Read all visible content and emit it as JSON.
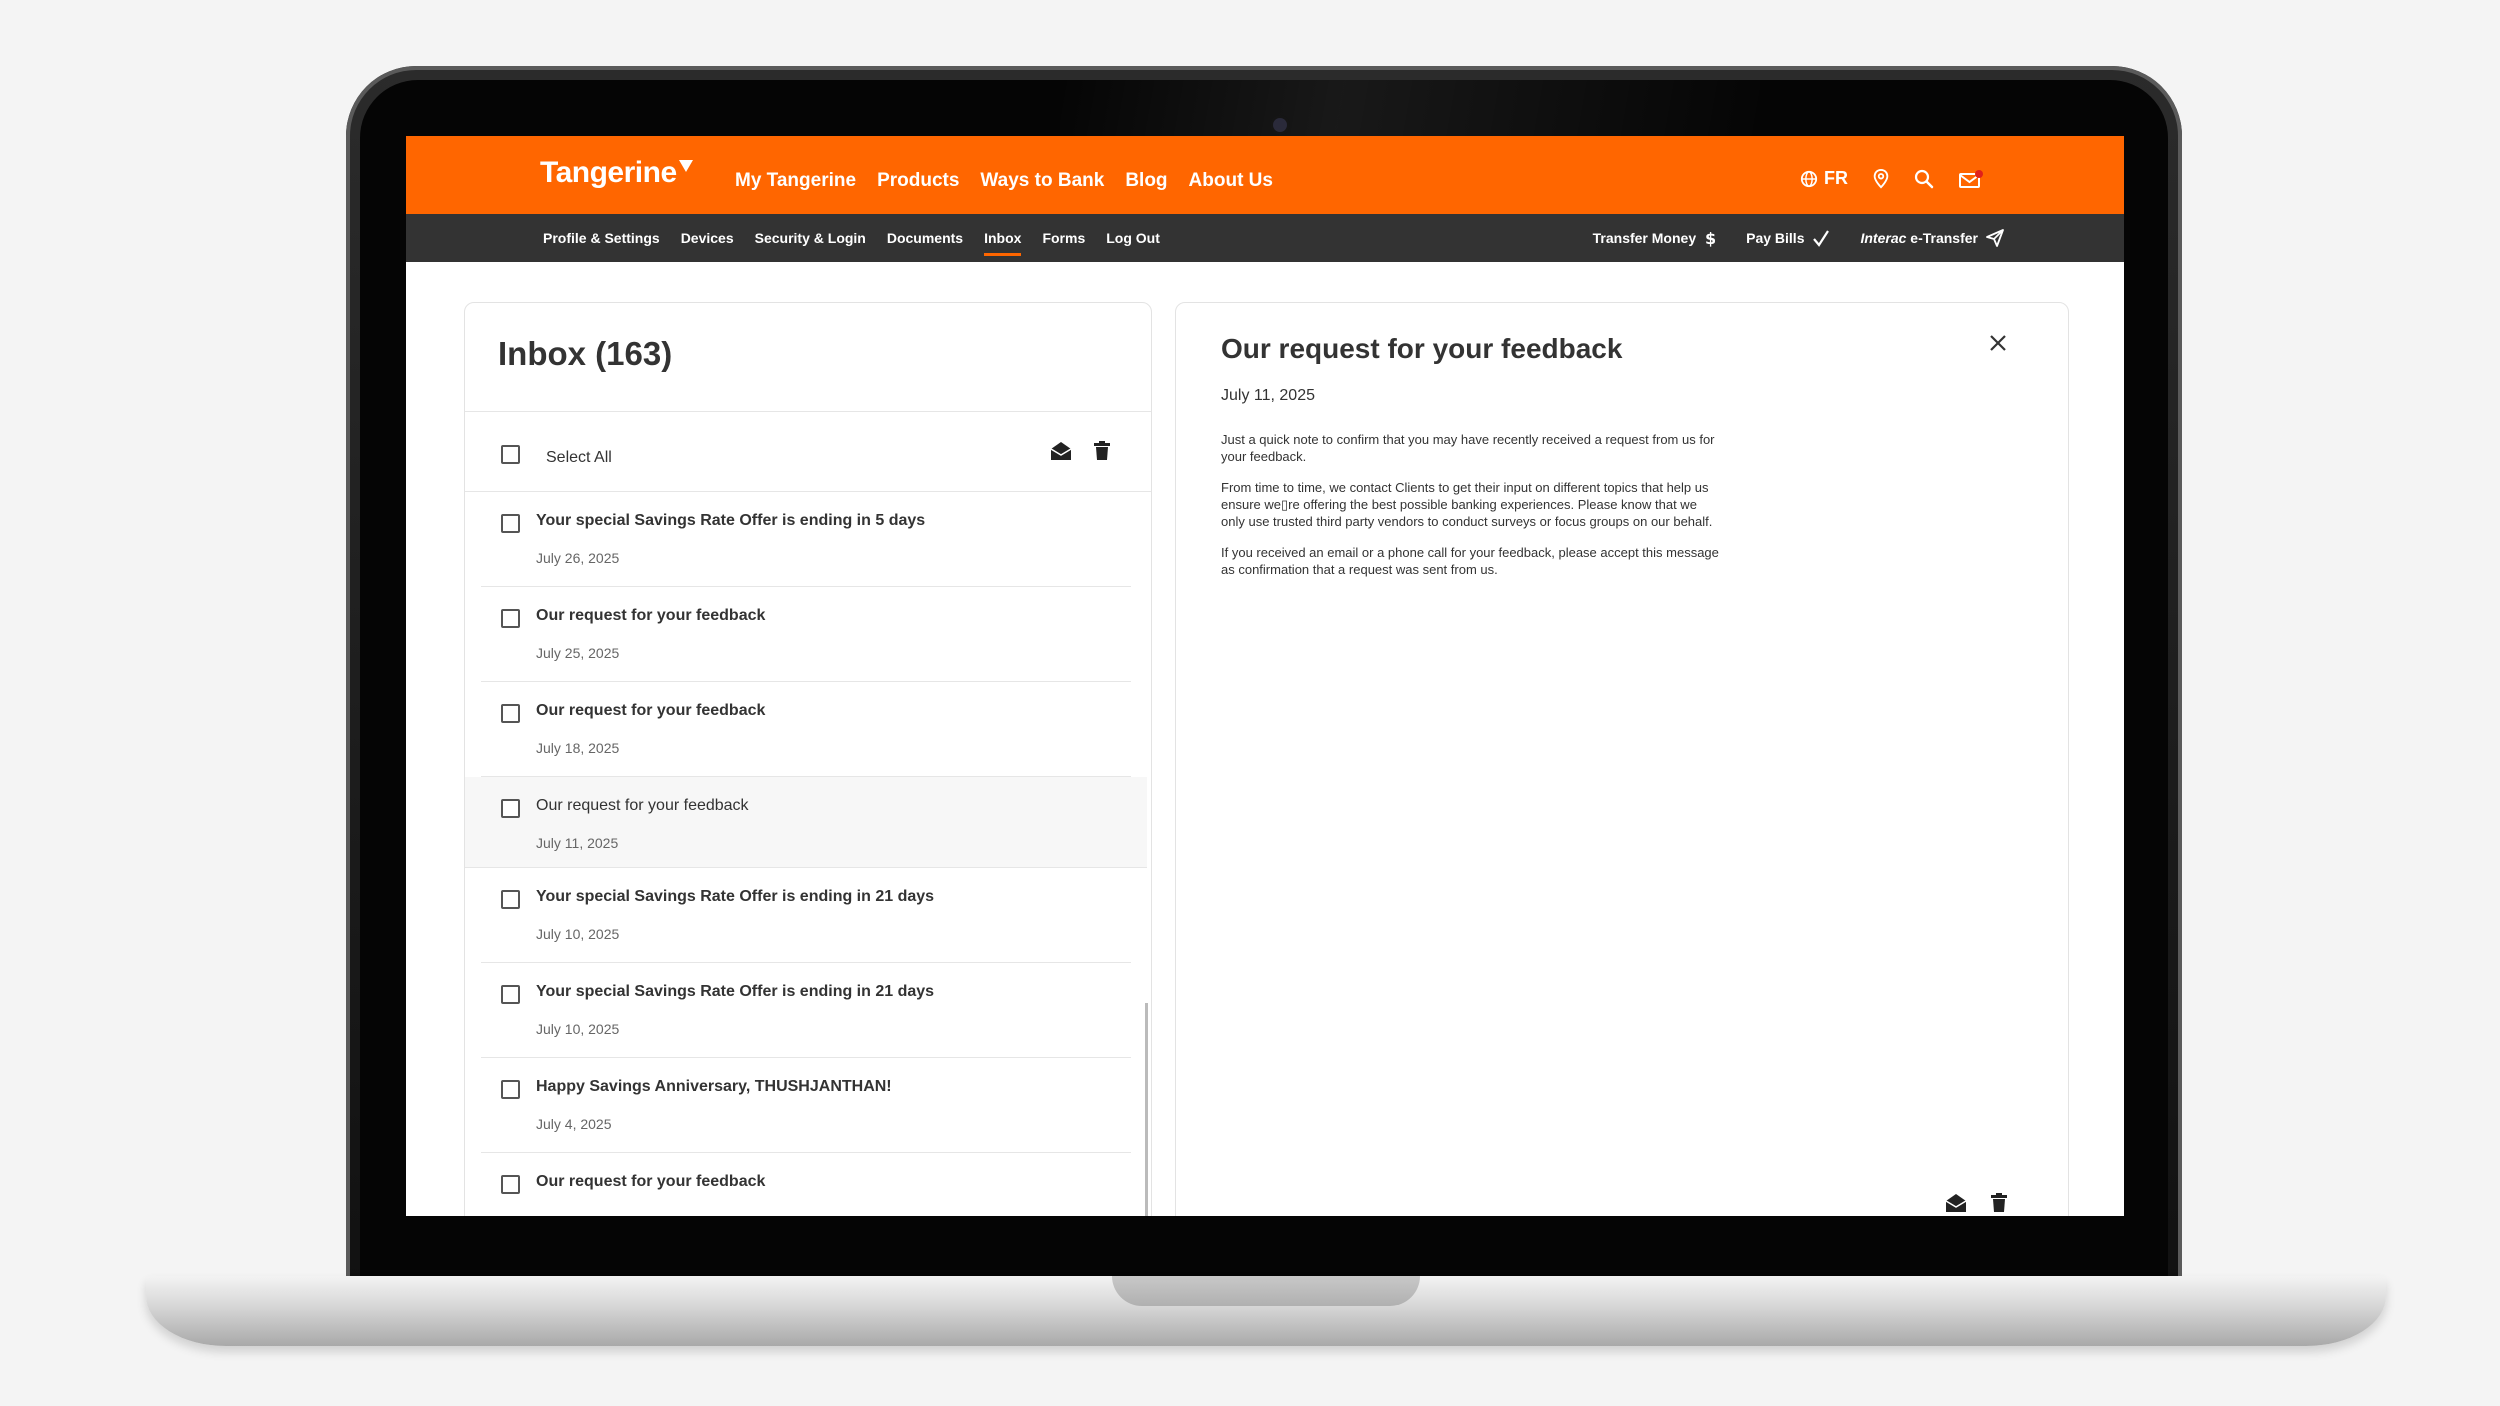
{
  "brand": {
    "name": "Tangerine",
    "color": "#ff6600"
  },
  "main_nav": [
    "My Tangerine",
    "Products",
    "Ways to Bank",
    "Blog",
    "About Us"
  ],
  "utility": {
    "language": "FR"
  },
  "sub_nav": [
    "Profile & Settings",
    "Devices",
    "Security & Login",
    "Documents",
    "Inbox",
    "Forms",
    "Log Out"
  ],
  "sub_nav_active": "Inbox",
  "quick_links": {
    "transfer": "Transfer Money",
    "pay_bills": "Pay Bills",
    "etransfer_italic": "Interac",
    "etransfer_rest": " e-Transfer"
  },
  "inbox": {
    "title": "Inbox (163)",
    "select_all": "Select All",
    "messages": [
      {
        "subject": "Your special Savings Rate Offer is ending in 5 days",
        "date": "July 26, 2025"
      },
      {
        "subject": "Our request for your feedback",
        "date": "July 25, 2025"
      },
      {
        "subject": "Our request for your feedback",
        "date": "July 18, 2025"
      },
      {
        "subject": "Our request for your feedback",
        "date": "July 11, 2025"
      },
      {
        "subject": "Your special Savings Rate Offer is ending in 21 days",
        "date": "July 10, 2025"
      },
      {
        "subject": "Your special Savings Rate Offer is ending in 21 days",
        "date": "July 10, 2025"
      },
      {
        "subject": "Happy Savings Anniversary, THUSHJANTHAN!",
        "date": "July 4, 2025"
      },
      {
        "subject": "Our request for your feedback",
        "date": ""
      }
    ]
  },
  "message": {
    "title": "Our request for your feedback",
    "date": "July 11, 2025",
    "paragraphs": [
      "Just a quick note to confirm that you may have recently received a request from us for your feedback.",
      "From time to time, we contact Clients to get their input on different topics that help us ensure we▯re offering the best possible banking experiences. Please know that we only use trusted third party vendors to conduct surveys or focus groups on our behalf.",
      "If you received an email or a phone call for your feedback, please accept this message as confirmation that a request was sent from us."
    ]
  }
}
